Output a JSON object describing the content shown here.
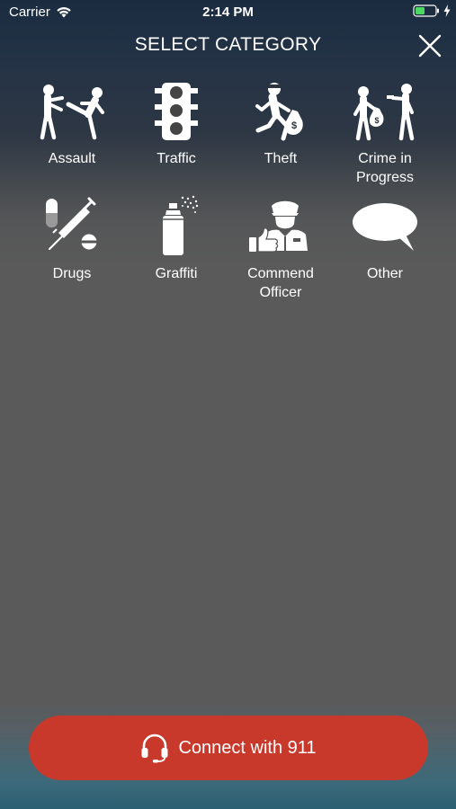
{
  "status_bar": {
    "carrier": "Carrier",
    "time": "2:14 PM",
    "icons": [
      "wifi-icon",
      "battery-icon",
      "charging-bolt-icon"
    ]
  },
  "header": {
    "title": "SELECT CATEGORY",
    "close_icon": "close-icon"
  },
  "categories": [
    {
      "label": "Assault",
      "icon": "assault-icon"
    },
    {
      "label": "Traffic",
      "icon": "traffic-light-icon"
    },
    {
      "label": "Theft",
      "icon": "theft-icon"
    },
    {
      "label": "Crime in Progress",
      "icon": "crime-in-progress-icon"
    },
    {
      "label": "Drugs",
      "icon": "drugs-icon"
    },
    {
      "label": "Graffiti",
      "icon": "spray-can-icon"
    },
    {
      "label": "Commend Officer",
      "icon": "commend-officer-icon"
    },
    {
      "label": "Other",
      "icon": "speech-bubble-icon"
    }
  ],
  "connect_button": {
    "label": "Connect with 911",
    "icon": "headset-icon",
    "color": "#c8392b"
  },
  "colors": {
    "background_top": "#1b2c40",
    "background_main": "#5a5a5a",
    "text": "#ffffff",
    "battery_fill": "#4cd964"
  }
}
